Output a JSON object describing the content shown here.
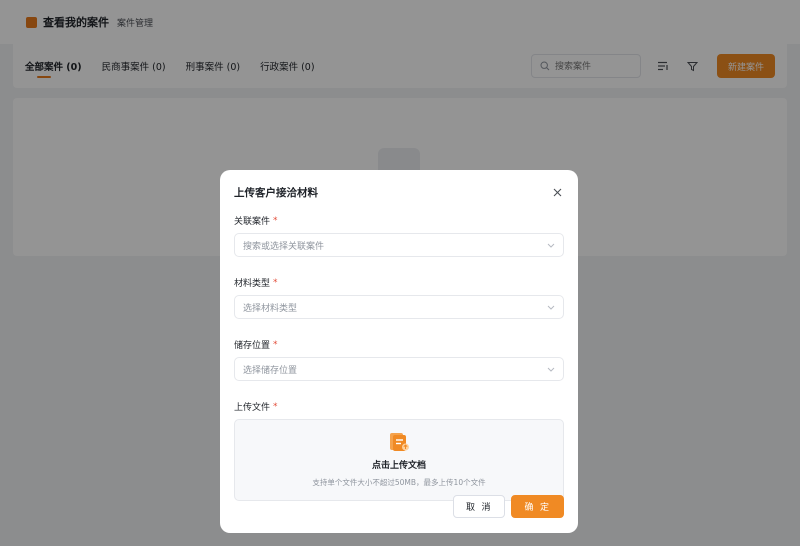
{
  "app": {
    "title": "查看我的案件",
    "subtitle": "案件管理"
  },
  "tabs": [
    {
      "label": "全部案件 (0)"
    },
    {
      "label": "民商事案件 (0)"
    },
    {
      "label": "刑事案件 (0)"
    },
    {
      "label": "行政案件 (0)"
    }
  ],
  "search": {
    "placeholder": "搜索案件"
  },
  "toolbar": {
    "new_button": "新建案件"
  },
  "modal": {
    "title": "上传客户接洽材料",
    "fields": {
      "case": {
        "label": "关联案件",
        "required": "*",
        "placeholder": "搜索或选择关联案件"
      },
      "type": {
        "label": "材料类型",
        "required": "*",
        "placeholder": "选择材料类型"
      },
      "location": {
        "label": "储存位置",
        "required": "*",
        "placeholder": "选择储存位置"
      },
      "upload": {
        "label": "上传文件",
        "required": "*",
        "title": "点击上传文档",
        "hint": "支持单个文件大小不超过50MB，最多上传10个文件"
      }
    },
    "cancel": "取 消",
    "confirm": "确 定"
  },
  "colors": {
    "accent": "#f08a24",
    "required": "#e34d3a"
  }
}
